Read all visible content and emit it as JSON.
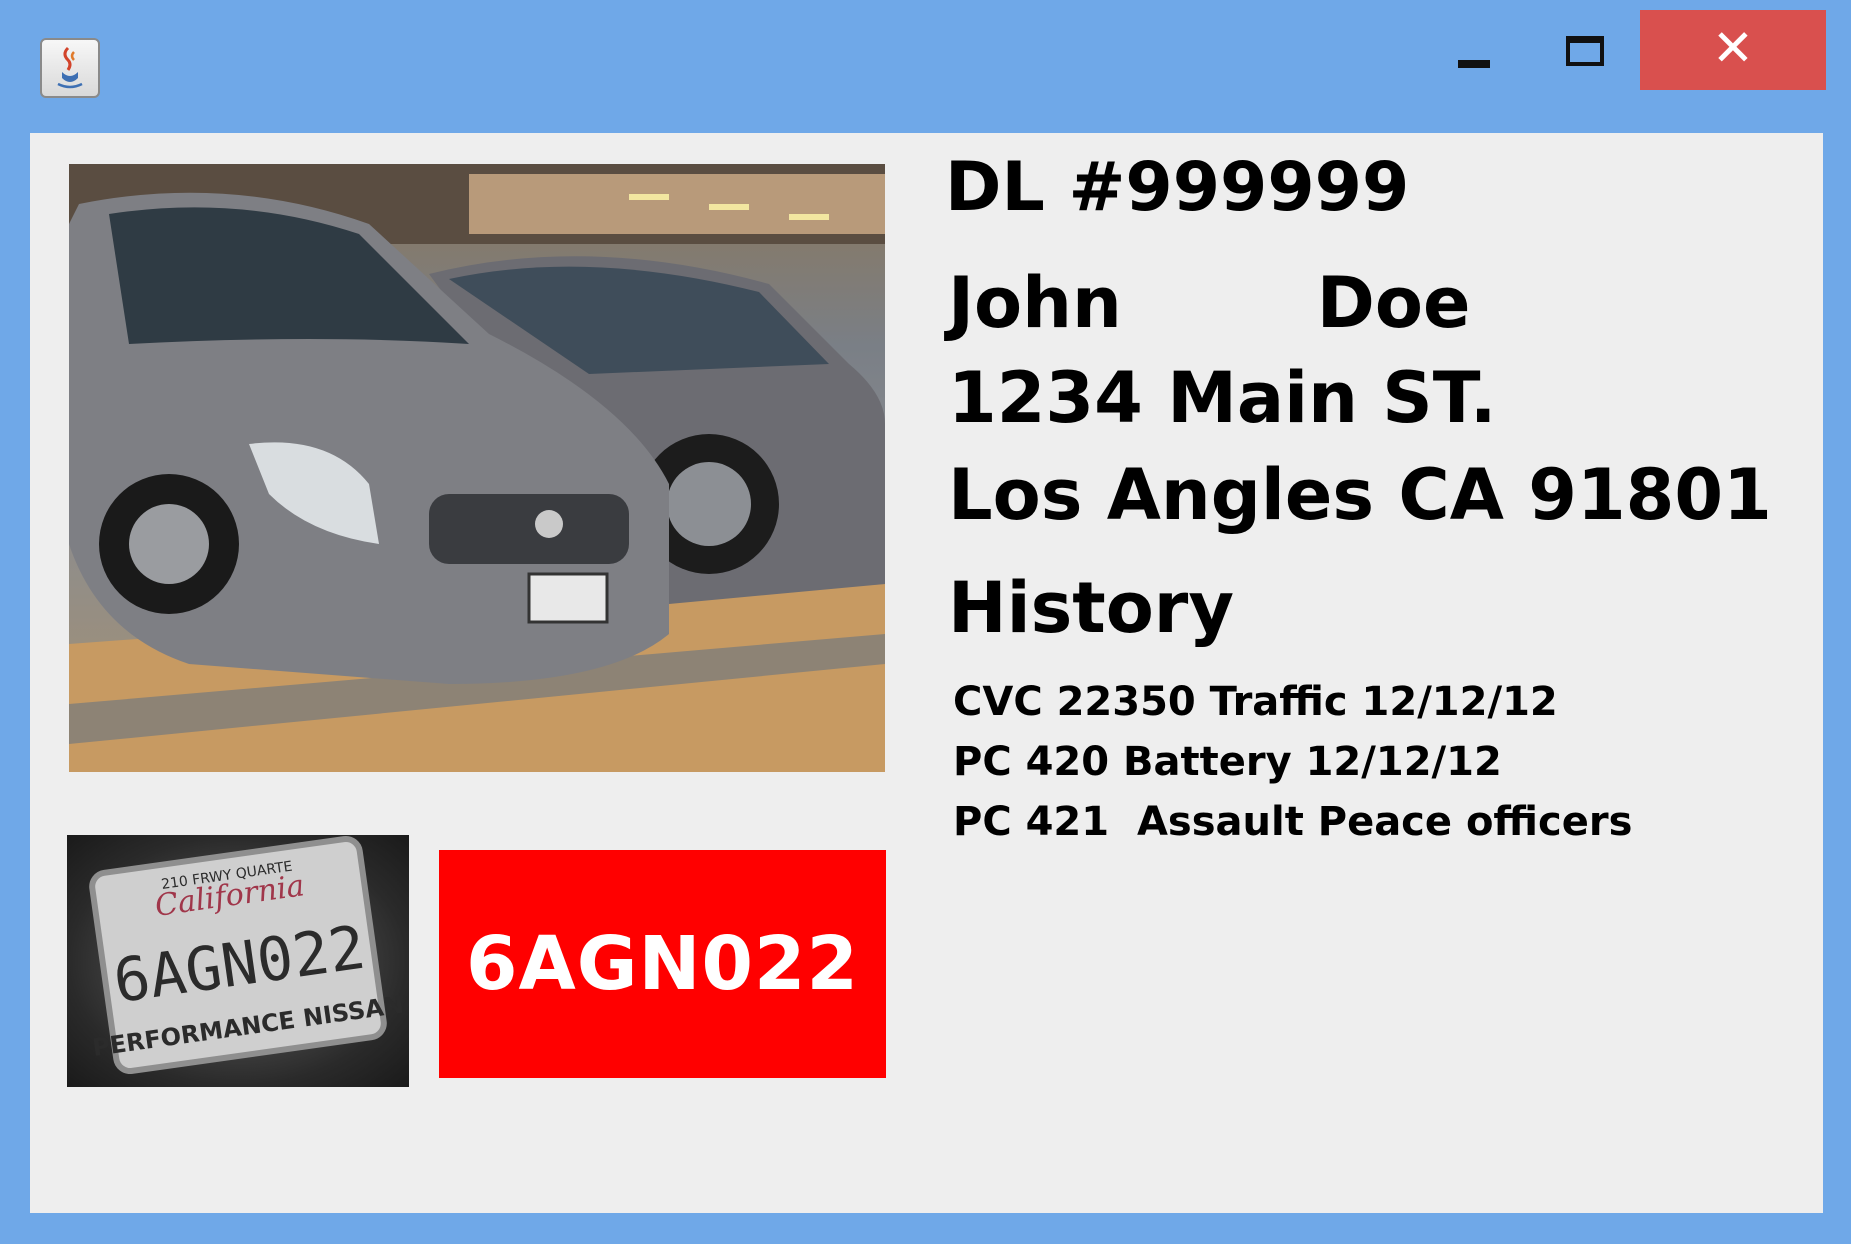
{
  "window": {
    "minimize_icon": "minimize-icon",
    "maximize_icon": "maximize-icon",
    "close_icon": "close-icon",
    "close_glyph": "✕",
    "app_icon": "java-cup-icon",
    "close_color": "#d9504e",
    "frame_color": "#6fa8e8"
  },
  "record": {
    "dl_number": "DL #999999",
    "name": "John        Doe",
    "address_line1": "1234 Main ST.",
    "address_line2": "Los Angles CA 91801",
    "history_heading": "History",
    "history": [
      "CVC 22350 Traffic 12/12/12",
      "PC 420 Battery 12/12/12",
      "PC 421  Assault Peace officers"
    ]
  },
  "plate": {
    "number": "6AGN022",
    "highlight_color": "#ff0000",
    "plate_photo_text": "6AGN022",
    "plate_frame_top": "210 FRWY QUARTE",
    "plate_frame_state": "California",
    "plate_frame_bottom": "PERFORMANCE NISSAN"
  }
}
